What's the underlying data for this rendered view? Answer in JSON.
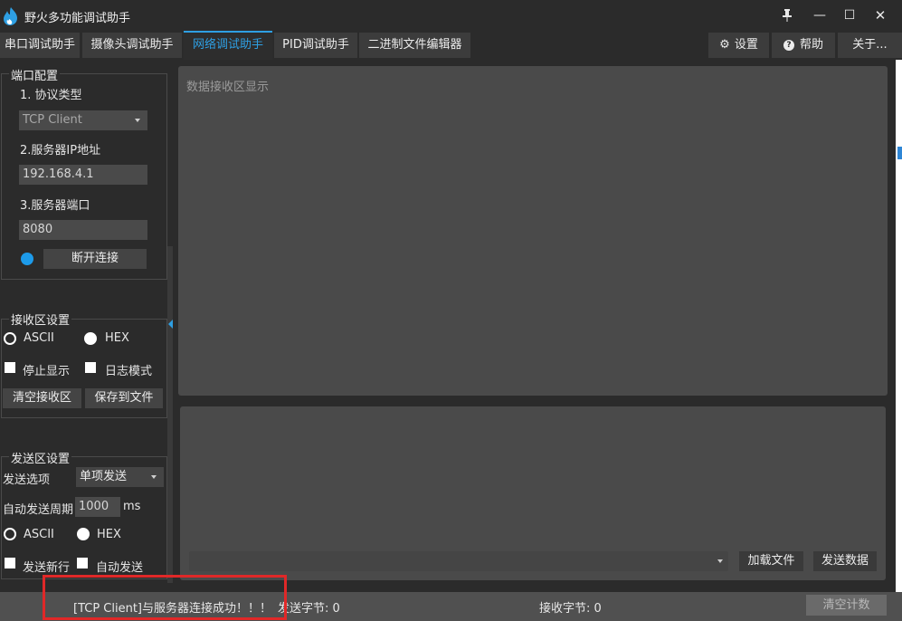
{
  "window": {
    "title": "野火多功能调试助手",
    "pin": "↑",
    "minimize": "—",
    "maximize": "☐",
    "close": "✕"
  },
  "tabs": [
    {
      "label": "串口调试助手"
    },
    {
      "label": "摄像头调试助手"
    },
    {
      "label": "网络调试助手"
    },
    {
      "label": "PID调试助手"
    },
    {
      "label": "二进制文件编辑器"
    }
  ],
  "active_tab": "网络调试助手",
  "right_tabs": {
    "settings": {
      "label": "设置",
      "icon": "gear-icon"
    },
    "help": {
      "label": "帮助",
      "icon": "help-icon"
    },
    "about": {
      "label": "关于..."
    }
  },
  "port_config": {
    "title": "端口配置",
    "protocol_label": "1. 协议类型",
    "protocol_value": "TCP Client",
    "ip_label": "2.服务器IP地址",
    "ip_value": "192.168.4.1",
    "port_label": "3.服务器端口",
    "port_value": "8080",
    "disconnect_button": "断开连接",
    "connected": true,
    "led_color": "#1d9bea"
  },
  "recv_settings": {
    "title": "接收区设置",
    "ascii_label": "ASCII",
    "hex_label": "HEX",
    "stop_display_label": "停止显示",
    "log_mode_label": "日志模式",
    "clear_button": "清空接收区",
    "save_button": "保存到文件"
  },
  "send_settings": {
    "title": "发送区设置",
    "option_label": "发送选项",
    "option_value": "单项发送",
    "period_label": "自动发送周期",
    "period_value": "1000",
    "period_unit": "ms",
    "ascii_label": "ASCII",
    "hex_label": "HEX",
    "newline_label": "发送新行",
    "auto_send_label": "自动发送"
  },
  "recv_area": {
    "placeholder": "数据接收区显示"
  },
  "send_area": {
    "load_file_button": "加载文件",
    "send_button": "发送数据"
  },
  "status": {
    "message": "[TCP Client]与服务器连接成功！！！",
    "sent_label": "发送字节: 0",
    "recv_label": "接收字节: 0",
    "clear_count_button": "清空计数"
  },
  "colors": {
    "accent": "#2e9fe3",
    "highlight_box": "#e02828",
    "background": "#2b2b2b"
  }
}
